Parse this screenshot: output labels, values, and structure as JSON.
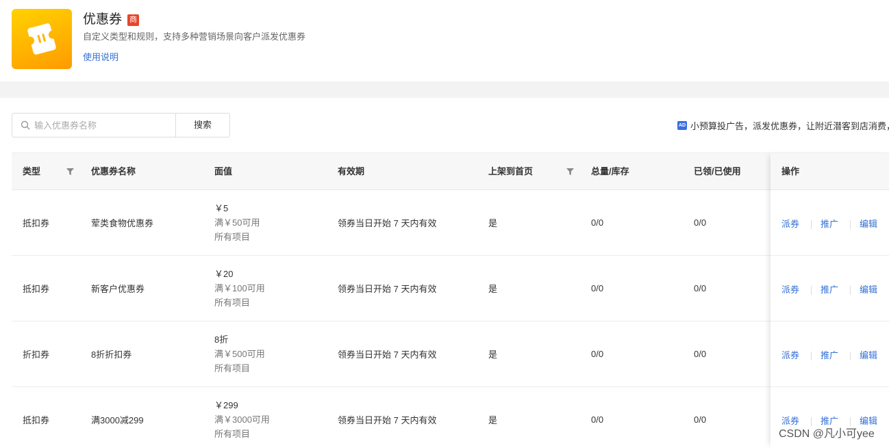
{
  "app": {
    "title": "优惠券",
    "badge": "商",
    "subtitle": "自定义类型和规则，支持多种营销场景向客户派发优惠券",
    "help_link": "使用说明",
    "icon": "coupon-ticket-icon",
    "icon_gradient": [
      "#ffd200",
      "#ff9a00"
    ]
  },
  "search": {
    "placeholder": "输入优惠券名称",
    "value": "",
    "button_label": "搜索",
    "icon": "search-icon"
  },
  "ad_banner": {
    "icon_label": "AD",
    "text": "小预算投广告，派发优惠券，让附近潜客到店消费，"
  },
  "table": {
    "columns": {
      "type": "类型",
      "name": "优惠券名称",
      "face": "面值",
      "validity": "有效期",
      "homepage": "上架到首页",
      "stock": "总量/库存",
      "used": "已领/已使用",
      "ops": "操作"
    },
    "rows": [
      {
        "type": "抵扣券",
        "name": "荤类食物优惠券",
        "amount": "￥5",
        "condition": "满￥50可用",
        "scope": "所有项目",
        "validity": "领券当日开始 7 天内有效",
        "homepage": "是",
        "stock": "0/0",
        "used": "0/0"
      },
      {
        "type": "抵扣券",
        "name": "新客户优惠券",
        "amount": "￥20",
        "condition": "满￥100可用",
        "scope": "所有项目",
        "validity": "领券当日开始 7 天内有效",
        "homepage": "是",
        "stock": "0/0",
        "used": "0/0"
      },
      {
        "type": "折扣券",
        "name": "8折折扣券",
        "amount": "8折",
        "condition": "满￥500可用",
        "scope": "所有项目",
        "validity": "领券当日开始 7 天内有效",
        "homepage": "是",
        "stock": "0/0",
        "used": "0/0"
      },
      {
        "type": "抵扣券",
        "name": "满3000减299",
        "amount": "￥299",
        "condition": "满￥3000可用",
        "scope": "所有项目",
        "validity": "领券当日开始 7 天内有效",
        "homepage": "是",
        "stock": "0/0",
        "used": "0/0"
      }
    ],
    "actions": [
      "派券",
      "推广",
      "编辑"
    ]
  },
  "watermark": "CSDN @凡小可yee",
  "colors": {
    "link": "#3370d6",
    "badge_red": "#e8452c",
    "header_bg": "#f7f7f8",
    "band_bg": "#f3f3f4"
  }
}
